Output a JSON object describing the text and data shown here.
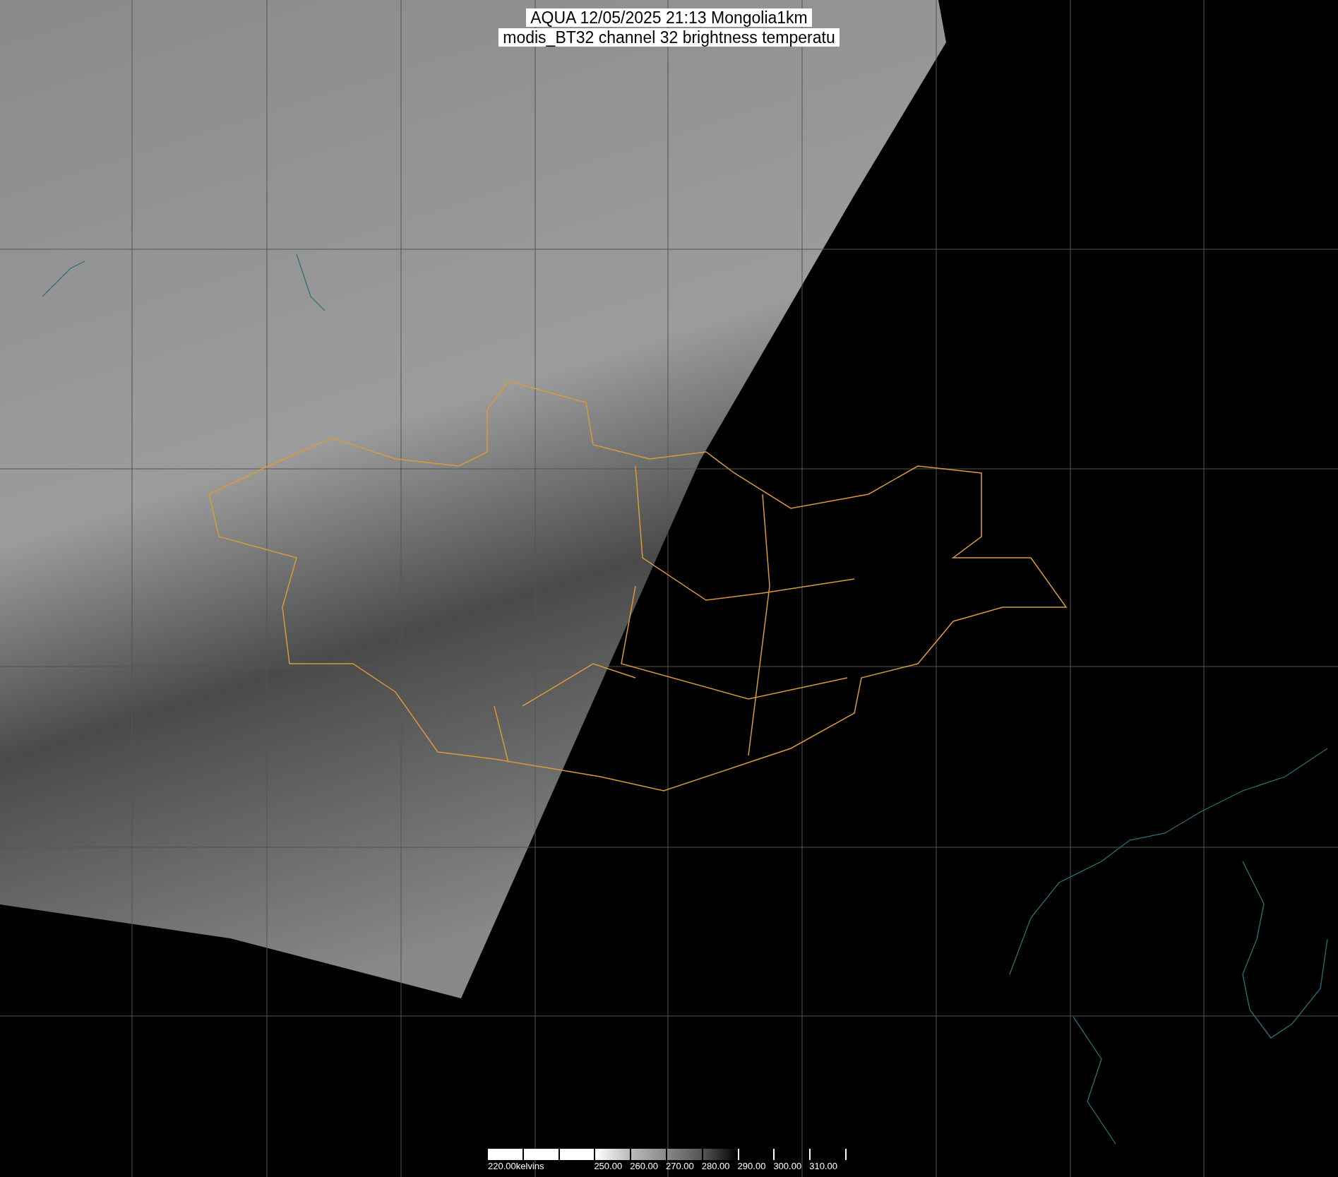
{
  "title_lines": [
    "AQUA 12/05/2025 21:13 Mongolia1km",
    "modis_BT32 channel 32 brightness temperatu"
  ],
  "colorbar": {
    "labels": [
      "220.00kelvins",
      "250.00",
      "260.00",
      "270.00",
      "280.00",
      "290.00",
      "300.00",
      "310.00"
    ]
  }
}
